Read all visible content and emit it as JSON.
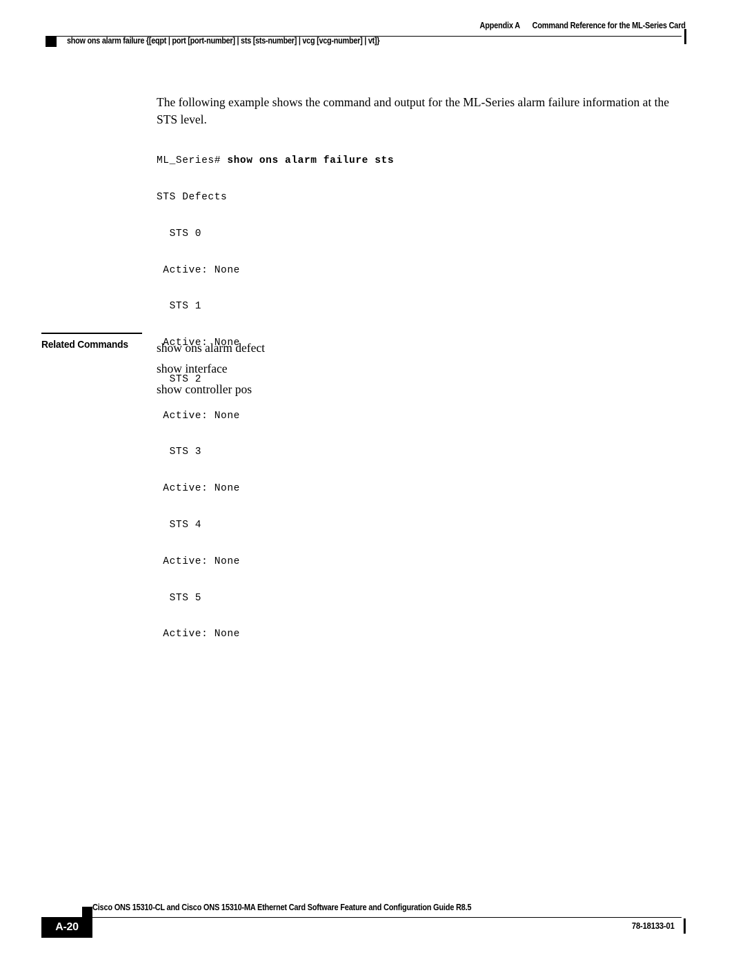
{
  "header": {
    "appendix": "Appendix A",
    "chapter_title": "Command Reference for the ML-Series Card",
    "command_title": "show ons alarm failure {[eqpt | port [port-number] | sts [sts-number] | vcg [vcg-number] | vt]}"
  },
  "main": {
    "intro_paragraph": "The following example shows the command and output for the ML-Series alarm failure information at the STS level.",
    "code_block": {
      "prompt": "ML_Series# ",
      "command": "show ons alarm failure sts",
      "output_lines": [
        "STS Defects",
        "  STS 0",
        " Active: None",
        "  STS 1",
        " Active: None",
        "  STS 2",
        " Active: None",
        "  STS 3",
        " Active: None",
        "  STS 4",
        " Active: None",
        "  STS 5",
        " Active: None"
      ]
    }
  },
  "related_commands": {
    "label": "Related Commands",
    "items": [
      "show ons alarm defect",
      "show interface",
      "show controller pos"
    ]
  },
  "footer": {
    "guide_title": "Cisco ONS 15310-CL and Cisco ONS 15310-MA Ethernet Card Software Feature and Configuration Guide R8.5",
    "page_number": "A-20",
    "document_number": "78-18133-01"
  }
}
